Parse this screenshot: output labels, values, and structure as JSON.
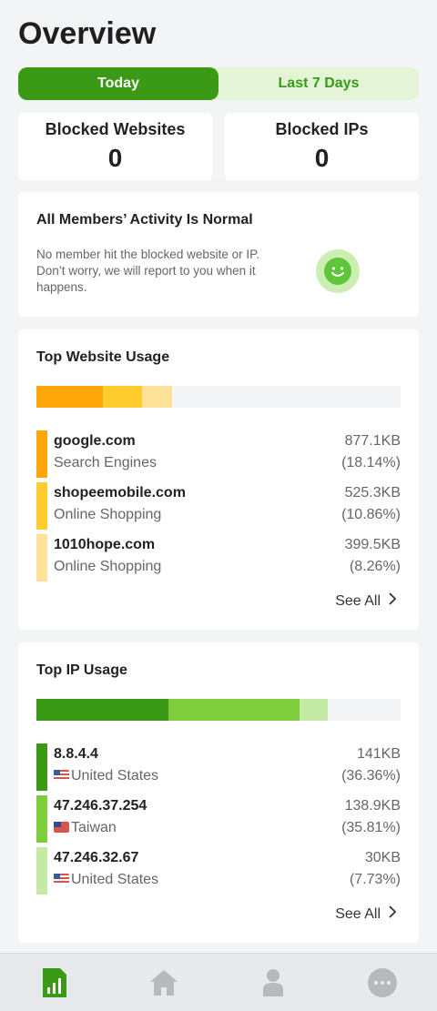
{
  "header": {
    "title": "Overview"
  },
  "tabs": [
    {
      "label": "Today",
      "active": true
    },
    {
      "label": "Last 7 Days",
      "active": false
    }
  ],
  "stats": {
    "blocked_websites": {
      "label": "Blocked Websites",
      "value": "0"
    },
    "blocked_ips": {
      "label": "Blocked IPs",
      "value": "0"
    }
  },
  "activity": {
    "title": "All Members’ Activity Is Normal",
    "description": "No member hit the blocked website or IP. Don’t worry, we will report to you when it happens.",
    "icon": "smiley-face-icon"
  },
  "top_website": {
    "title": "Top Website Usage",
    "bar": {
      "colors": [
        "#ffa60a",
        "#ffcc2e",
        "#ffe29a"
      ],
      "percents": [
        18.14,
        10.86,
        8.26
      ]
    },
    "items": [
      {
        "name": "google.com",
        "category": "Search Engines",
        "size": "877.1KB",
        "percent": "(18.14%)",
        "color": "#ffa60a"
      },
      {
        "name": "shopeemobile.com",
        "category": "Online Shopping",
        "size": "525.3KB",
        "percent": "(10.86%)",
        "color": "#ffcc2e"
      },
      {
        "name": "1010hope.com",
        "category": "Online Shopping",
        "size": "399.5KB",
        "percent": "(8.26%)",
        "color": "#ffe29a"
      }
    ],
    "see_all": "See All"
  },
  "top_ip": {
    "title": "Top IP Usage",
    "bar": {
      "colors": [
        "#3a9a16",
        "#7fcc3c",
        "#c4eaa6"
      ],
      "percents": [
        36.36,
        35.81,
        7.73
      ]
    },
    "items": [
      {
        "name": "8.8.4.4",
        "country": "United States",
        "flag": "us",
        "size": "141KB",
        "percent": "(36.36%)",
        "color": "#3a9a16"
      },
      {
        "name": "47.246.37.254",
        "country": "Taiwan",
        "flag": "tw",
        "size": "138.9KB",
        "percent": "(35.81%)",
        "color": "#7fcc3c"
      },
      {
        "name": "47.246.32.67",
        "country": "United States",
        "flag": "us",
        "size": "30KB",
        "percent": "(7.73%)",
        "color": "#c4eaa6"
      }
    ],
    "see_all": "See All"
  },
  "bottom_nav": {
    "items": [
      {
        "icon": "report-chart-icon",
        "active": true
      },
      {
        "icon": "home-icon",
        "active": false
      },
      {
        "icon": "person-icon",
        "active": false
      },
      {
        "icon": "more-icon",
        "active": false
      }
    ],
    "active_color": "#3a9a16",
    "inactive_color": "#b7b9bd"
  }
}
